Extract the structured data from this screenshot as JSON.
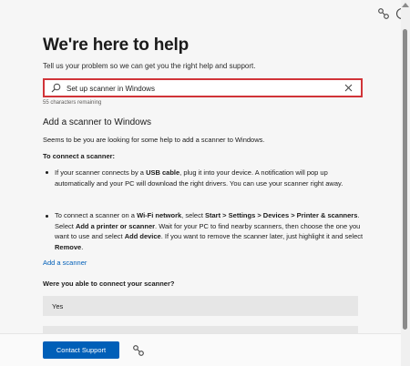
{
  "header": {
    "share_icon": "share-icon",
    "info_icon": "info-icon"
  },
  "page": {
    "title": "We're here to help",
    "subtitle": "Tell us your problem so we can get you the right help and support."
  },
  "search": {
    "value": "Set up scanner in Windows",
    "chars_remaining": "55 characters remaining",
    "border_color": "#d13438"
  },
  "article": {
    "title": "Add a scanner to Windows",
    "intro": "Seems to be you are looking for some help to add a scanner to Windows.",
    "subhead": "To connect a scanner:",
    "bullet1": {
      "p1": "If your scanner connects by a ",
      "b1": "USB cable",
      "p2": ", plug it into your device. A notification will pop up automatically and your PC will download the right drivers. You can use your scanner right away."
    },
    "bullet2": {
      "p1": "To connect a scanner on a ",
      "b1": "Wi-Fi network",
      "p2": ", select ",
      "b2": "Start > Settings > Devices > Printer & scanners",
      "p3": ". Select ",
      "b3": "Add a printer or scanner",
      "p4": ". Wait for your PC to find nearby scanners, then choose the one you want to use and select ",
      "b4": "Add device",
      "p5": ". If you want to remove the scanner later, just highlight it and select ",
      "b5": "Remove",
      "p6": "."
    },
    "link": "Add a scanner"
  },
  "feedback": {
    "question": "Were you able to connect your scanner?",
    "yes": "Yes",
    "no": ""
  },
  "footer": {
    "contact_label": "Contact Support",
    "accent": "#005fb8"
  }
}
